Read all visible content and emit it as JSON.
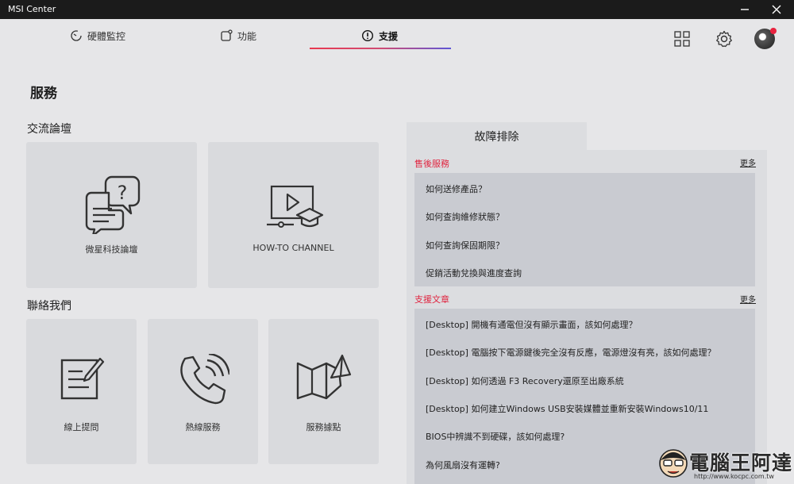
{
  "window": {
    "title": "MSI Center"
  },
  "tabs": [
    {
      "label": "硬體監控",
      "icon": "gauge-icon"
    },
    {
      "label": "功能",
      "icon": "feature-icon"
    },
    {
      "label": "支援",
      "icon": "exclamation-circle-icon",
      "active": true
    }
  ],
  "toolbar_icons": [
    "grid-icon",
    "gear-icon",
    "avatar"
  ],
  "page": {
    "title": "服務",
    "forum_section": {
      "label": "交流論壇",
      "cards": [
        {
          "label": "微星科技論壇",
          "icon": "chat-question-icon"
        },
        {
          "label": "HOW-TO CHANNEL",
          "icon": "video-tutorial-icon"
        }
      ]
    },
    "contact_section": {
      "label": "聯絡我們",
      "cards": [
        {
          "label": "線上提問",
          "icon": "note-pen-icon"
        },
        {
          "label": "熱線服務",
          "icon": "phone-call-icon"
        },
        {
          "label": "服務據點",
          "icon": "map-pin-icon"
        }
      ]
    }
  },
  "troubleshoot": {
    "tab_label": "故障排除",
    "after_sales": {
      "heading": "售後服務",
      "more": "更多",
      "items": [
        "如何送修產品？",
        "如何查詢維修狀態？",
        "如何查詢保固期限？",
        "促銷活動兌換與進度查詢"
      ]
    },
    "articles": {
      "heading": "支援文章",
      "more": "更多",
      "items": [
        "[Desktop] 開機有通電但沒有顯示畫面，該如何處理？",
        "[Desktop] 電腦按下電源鍵後完全沒有反應，電源燈沒有亮，該如何處理？",
        "[Desktop] 如何透過 F3 Recovery還原至出廠系統",
        "[Desktop] 如何建立Windows USB安裝媒體並重新安裝Windows10/11",
        "BIOS中辨識不到硬碟，該如何處理?",
        "為何風扇沒有運轉?"
      ]
    }
  },
  "watermark": {
    "text": "電腦王阿達",
    "url": "http://www.kocpc.com.tw"
  },
  "colors": {
    "accent_red": "#e0243f",
    "accent_blue": "#5e56d6",
    "background": "#e6e6e8",
    "card": "#d9dadd"
  }
}
